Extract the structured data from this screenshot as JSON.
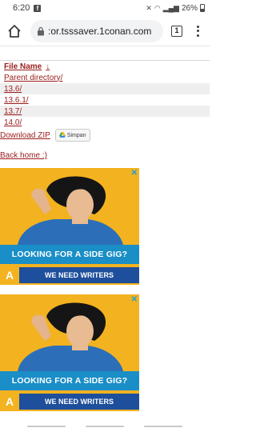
{
  "status_bar": {
    "time": "6:20",
    "battery": "26%"
  },
  "browser": {
    "url": ":or.tsssaver.1conan.com",
    "tab_count": "1"
  },
  "listing": {
    "column_header": "File Name",
    "sort_indicator": "↓",
    "rows": [
      {
        "name": "Parent directory/"
      },
      {
        "name": "13.6/"
      },
      {
        "name": "13.6.1/"
      },
      {
        "name": "13.7/"
      },
      {
        "name": "14.0/"
      }
    ]
  },
  "actions": {
    "download_label": "Download ZIP",
    "save_label": "Simpan",
    "back_home_label": "Back home :)"
  },
  "ads": [
    {
      "headline": "LOOKING FOR A SIDE GIG?",
      "subline": "WE NEED WRITERS",
      "logo": "A",
      "close": "✕"
    },
    {
      "headline": "LOOKING FOR A SIDE GIG?",
      "subline": "WE NEED WRITERS",
      "logo": "A",
      "close": "✕"
    }
  ],
  "colors": {
    "link": "#9b1c1c",
    "ad_background": "#f3b21f",
    "ad_banner": "#1a8ec7",
    "ad_subbar": "#1e4f9c"
  }
}
